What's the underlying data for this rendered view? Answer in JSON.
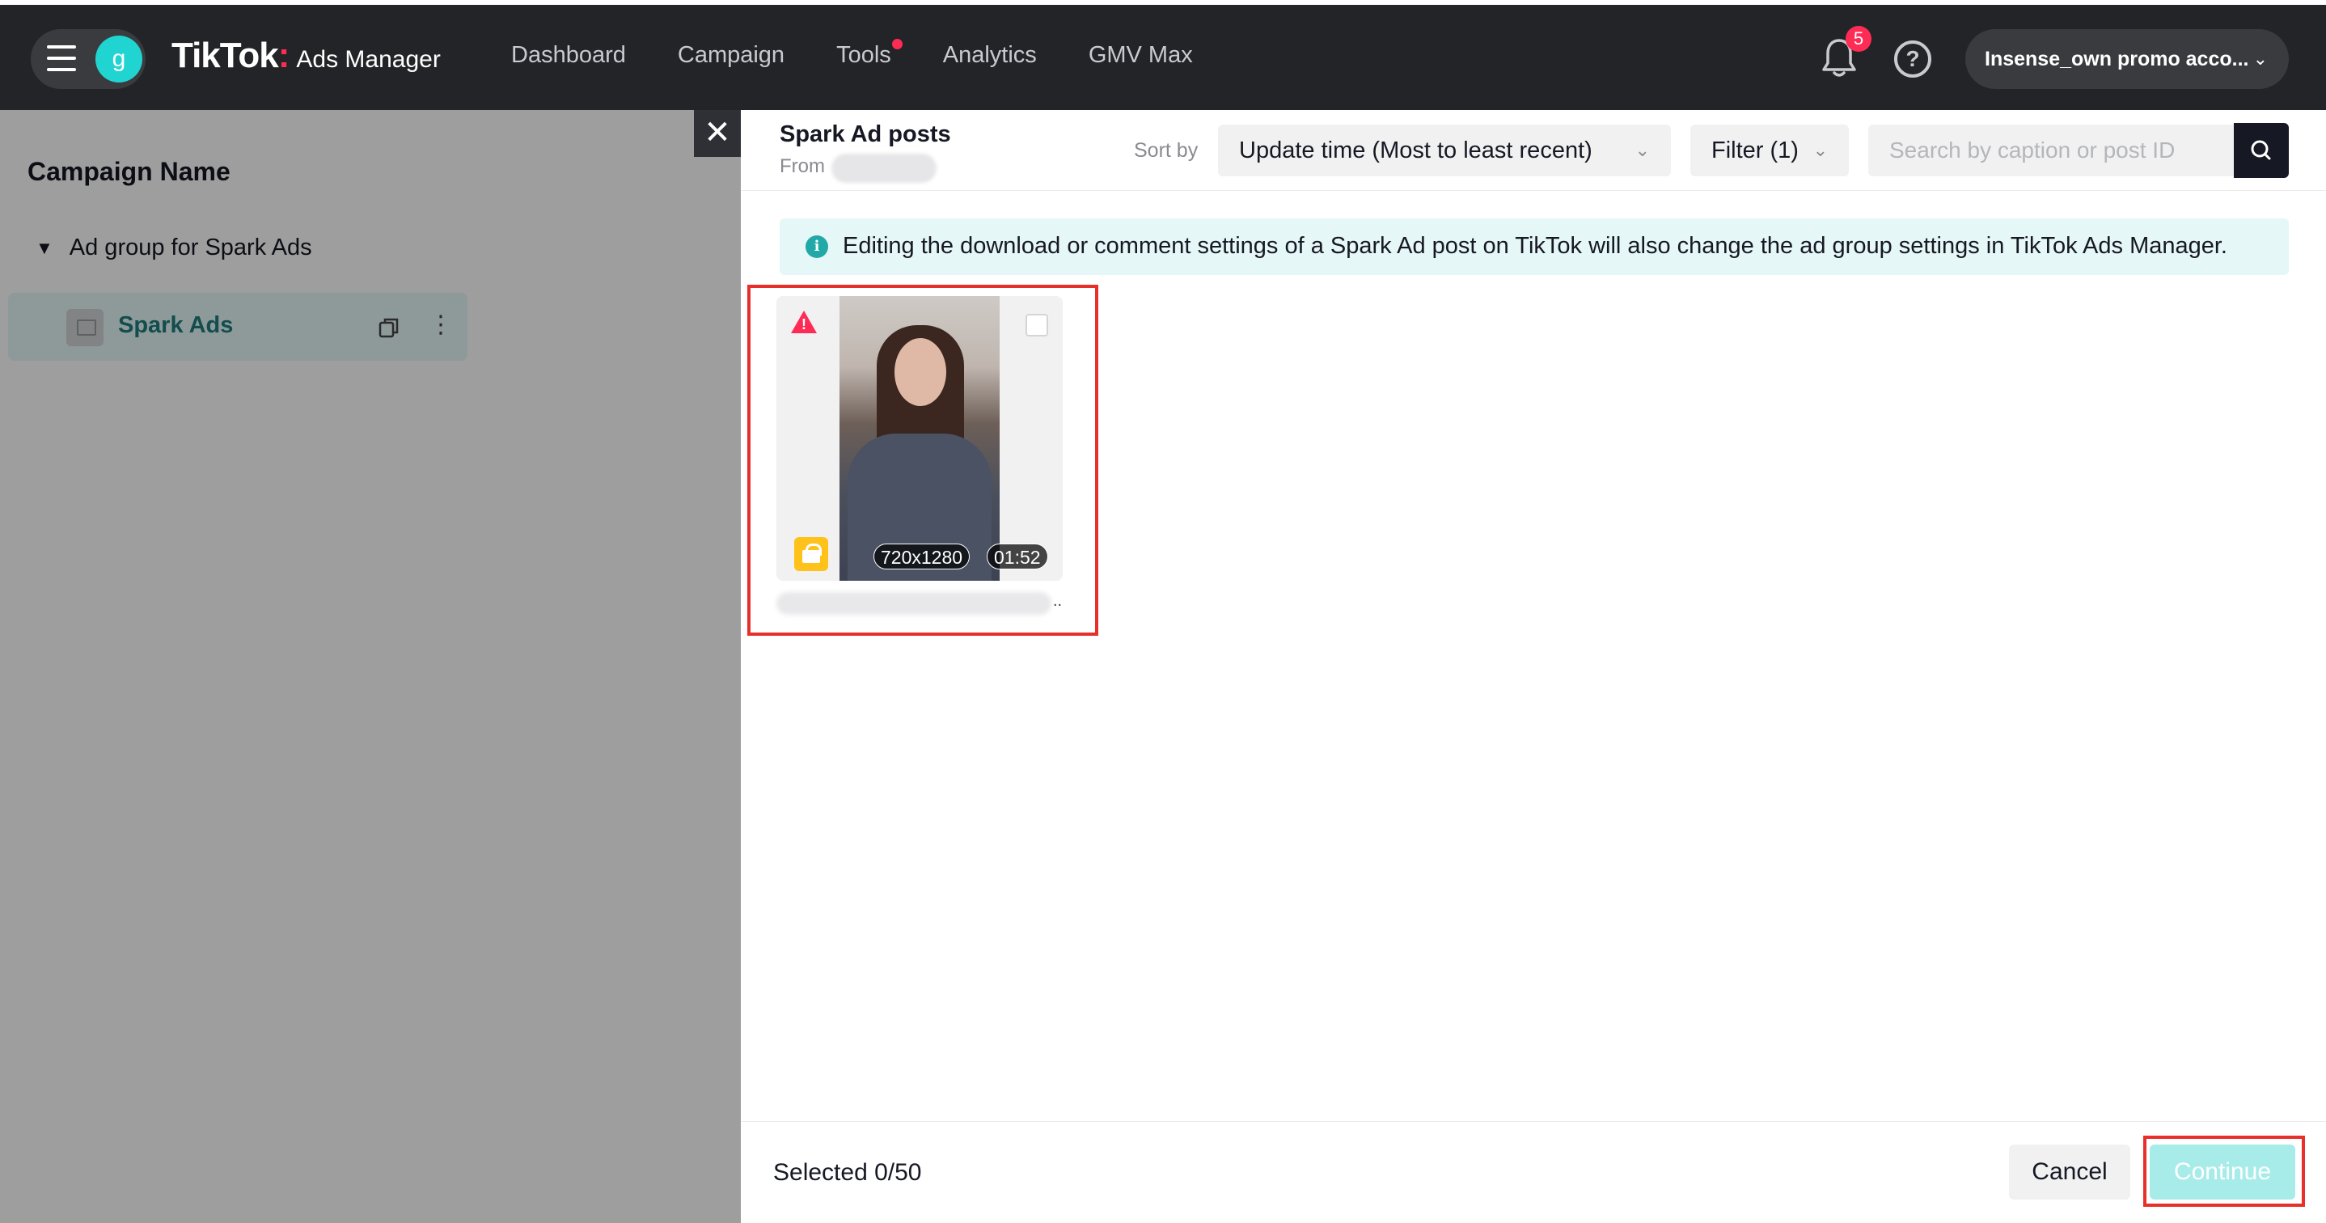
{
  "nav": {
    "avatar_letter": "g",
    "logo_brand": "TikTok",
    "logo_product": "Ads Manager",
    "links": [
      "Dashboard",
      "Campaign",
      "Tools",
      "Analytics",
      "GMV Max"
    ],
    "notification_count": "5",
    "help_glyph": "?",
    "account_name": "Insense_own promo acco...",
    "accent_color": "#fe2c55"
  },
  "sidebar": {
    "title": "Campaign Name",
    "ad_group": "Ad group for Spark Ads",
    "ad_item": "Spark Ads"
  },
  "drawer": {
    "close_glyph": "✕",
    "title": "Spark Ad posts",
    "from_label": "From",
    "sort_label": "Sort by",
    "sort_value": "Update time (Most to least recent)",
    "filter_label": "Filter (1)",
    "search_placeholder": "Search by caption or post ID",
    "info_glyph": "i",
    "info_text": "Editing the download or comment settings of a Spark Ad post on TikTok will also change the ad group settings in TikTok Ads Manager.",
    "posts": [
      {
        "resolution": "720x1280",
        "duration": "01:52",
        "warning_icon": "warning-icon",
        "shop_icon": "shopping-bag-icon"
      }
    ]
  },
  "footer": {
    "selected_text": "Selected 0/50",
    "cancel_label": "Cancel",
    "continue_label": "Continue"
  }
}
